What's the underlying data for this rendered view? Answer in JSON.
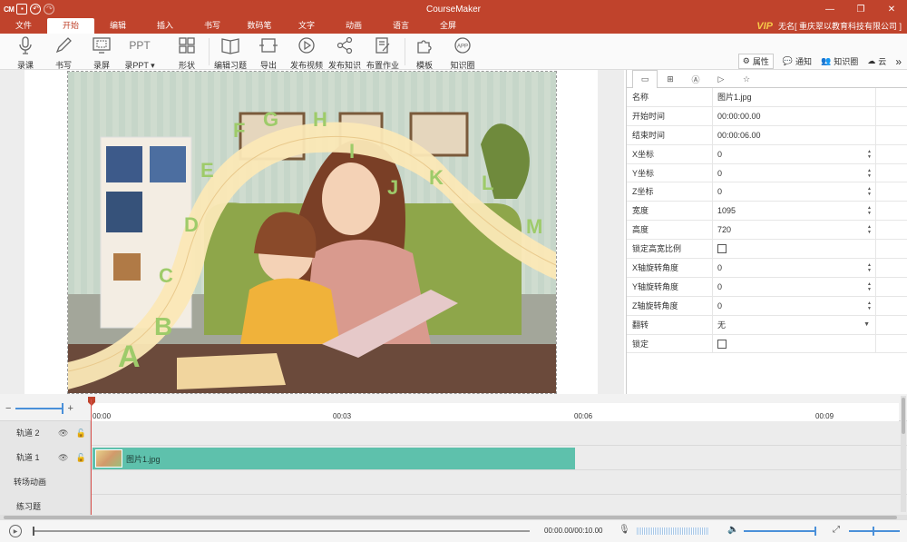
{
  "titlebar": {
    "logo": "CM",
    "title": "CourseMaker",
    "min": "—",
    "max": "❐",
    "close": "✕"
  },
  "menu": {
    "items": [
      "文件",
      "开始",
      "编辑",
      "插入",
      "书写",
      "数码笔",
      "文字",
      "动画",
      "语言",
      "全屏"
    ],
    "vip": "VIP",
    "user": "无名[ 重庆翠以教育科技有限公司 ]"
  },
  "ribbon": {
    "buttons": [
      "录课",
      "书写",
      "录屏",
      "录PPT",
      "形状",
      "编辑习题",
      "导出",
      "发布视频",
      "发布知识",
      "布置作业",
      "模板",
      "知识圈"
    ],
    "right": [
      "属性",
      "通知",
      "知识圈",
      "云"
    ],
    "more": "»"
  },
  "properties": {
    "rows": [
      {
        "key": "名称",
        "value": "图片1.jpg"
      },
      {
        "key": "开始时间",
        "value": "00:00:00.00"
      },
      {
        "key": "结束时间",
        "value": "00:00:06.00"
      },
      {
        "key": "X坐标",
        "value": "0"
      },
      {
        "key": "Y坐标",
        "value": "0"
      },
      {
        "key": "Z坐标",
        "value": "0"
      },
      {
        "key": "宽度",
        "value": "1095"
      },
      {
        "key": "高度",
        "value": "720"
      },
      {
        "key": "锁定高宽比例",
        "value": ""
      },
      {
        "key": "X轴旋转角度",
        "value": "0"
      },
      {
        "key": "Y轴旋转角度",
        "value": "0"
      },
      {
        "key": "Z轴旋转角度",
        "value": "0"
      },
      {
        "key": "翻转",
        "value": "无"
      },
      {
        "key": "锁定",
        "value": ""
      }
    ]
  },
  "image": {
    "letters": [
      "A",
      "B",
      "C",
      "D",
      "E",
      "F",
      "G",
      "H",
      "I",
      "J",
      "K",
      "L",
      "M"
    ]
  },
  "timeline": {
    "zoom_minus": "−",
    "zoom_plus": "+",
    "ticks": [
      "00:00",
      "00:03",
      "00:06",
      "00:09"
    ],
    "tracks": [
      {
        "label": "轨道 2"
      },
      {
        "label": "轨道 1",
        "clip": "图片1.jpg"
      },
      {
        "label": "转场动画"
      },
      {
        "label": "练习题"
      }
    ],
    "time": "00:00.00/00:10.00"
  }
}
